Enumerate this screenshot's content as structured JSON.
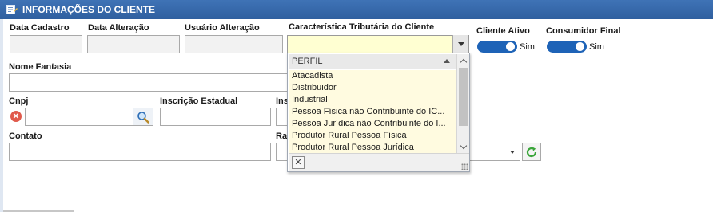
{
  "header": {
    "title": "INFORMAÇÕES DO CLIENTE"
  },
  "fields": {
    "data_cadastro": {
      "label": "Data Cadastro",
      "value": ""
    },
    "data_alteracao": {
      "label": "Data Alteração",
      "value": ""
    },
    "usuario_alteracao": {
      "label": "Usuário Alteração",
      "value": ""
    },
    "caracteristica_tributaria": {
      "label": "Característica Tributária do Cliente",
      "value": ""
    },
    "cliente_ativo": {
      "label": "Cliente Ativo",
      "state": "Sim"
    },
    "consumidor_final": {
      "label": "Consumidor Final",
      "state": "Sim"
    },
    "nome_fantasia": {
      "label": "Nome Fantasia",
      "value": ""
    },
    "cnpj": {
      "label": "Cnpj",
      "value": ""
    },
    "inscricao_estadual": {
      "label": "Inscrição Estadual",
      "value": ""
    },
    "inscricao_municipal": {
      "label": "Ins",
      "value": ""
    },
    "contato": {
      "label": "Contato",
      "value": ""
    },
    "ramo": {
      "label": "Ra",
      "value": ""
    }
  },
  "dropdown": {
    "column_header": "PERFIL",
    "options": [
      "Atacadista",
      "Distribuidor",
      "Industrial",
      "Pessoa Física não Contribuinte do IC...",
      "Pessoa Jurídica não Contribuinte do I...",
      "Produtor Rural Pessoa Física",
      "Produtor Rural Pessoa Jurídica"
    ]
  },
  "colors": {
    "title_bar": "#3567a9",
    "toggle": "#1e63b7",
    "dropdown_bg": "#fffbe0",
    "error": "#e05a4c",
    "refresh": "#3aa53a"
  }
}
